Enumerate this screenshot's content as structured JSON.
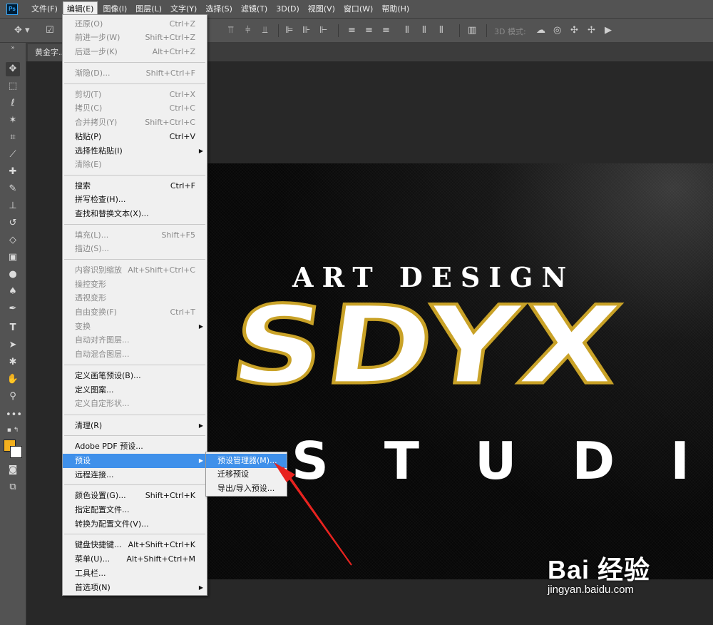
{
  "app": {
    "logo": "Ps"
  },
  "menubar": [
    "文件(F)",
    "编辑(E)",
    "图像(I)",
    "图层(L)",
    "文字(Y)",
    "选择(S)",
    "滤镜(T)",
    "3D(D)",
    "视图(V)",
    "窗口(W)",
    "帮助(H)"
  ],
  "options": {
    "mode3d_label": "3D 模式:"
  },
  "document": {
    "tab_label": "黄金字..."
  },
  "canvas": {
    "art_line": "ART DESIGN",
    "main_logo": "SDYX",
    "studio_line": "STUDI"
  },
  "edit_menu": {
    "items": [
      {
        "label": "还原(O)",
        "shortcut": "Ctrl+Z",
        "disabled": true
      },
      {
        "label": "前进一步(W)",
        "shortcut": "Shift+Ctrl+Z",
        "disabled": true
      },
      {
        "label": "后退一步(K)",
        "shortcut": "Alt+Ctrl+Z",
        "disabled": true
      },
      {
        "label": "渐隐(D)...",
        "shortcut": "Shift+Ctrl+F",
        "disabled": true
      },
      {
        "label": "剪切(T)",
        "shortcut": "Ctrl+X",
        "disabled": true
      },
      {
        "label": "拷贝(C)",
        "shortcut": "Ctrl+C",
        "disabled": true
      },
      {
        "label": "合并拷贝(Y)",
        "shortcut": "Shift+Ctrl+C",
        "disabled": true
      },
      {
        "label": "粘贴(P)",
        "shortcut": "Ctrl+V",
        "disabled": false
      },
      {
        "label": "选择性粘贴(I)",
        "shortcut": "",
        "disabled": false,
        "submenu": true
      },
      {
        "label": "清除(E)",
        "shortcut": "",
        "disabled": true
      },
      {
        "label": "搜索",
        "shortcut": "Ctrl+F",
        "disabled": false
      },
      {
        "label": "拼写检查(H)...",
        "shortcut": "",
        "disabled": false
      },
      {
        "label": "查找和替换文本(X)...",
        "shortcut": "",
        "disabled": false
      },
      {
        "label": "填充(L)...",
        "shortcut": "Shift+F5",
        "disabled": true
      },
      {
        "label": "描边(S)...",
        "shortcut": "",
        "disabled": true
      },
      {
        "label": "内容识别缩放",
        "shortcut": "Alt+Shift+Ctrl+C",
        "disabled": true
      },
      {
        "label": "操控变形",
        "shortcut": "",
        "disabled": true
      },
      {
        "label": "透视变形",
        "shortcut": "",
        "disabled": true
      },
      {
        "label": "自由变换(F)",
        "shortcut": "Ctrl+T",
        "disabled": true
      },
      {
        "label": "变换",
        "shortcut": "",
        "disabled": true,
        "submenu": true
      },
      {
        "label": "自动对齐图层...",
        "shortcut": "",
        "disabled": true
      },
      {
        "label": "自动混合图层...",
        "shortcut": "",
        "disabled": true
      },
      {
        "label": "定义画笔预设(B)...",
        "shortcut": "",
        "disabled": false
      },
      {
        "label": "定义图案...",
        "shortcut": "",
        "disabled": false
      },
      {
        "label": "定义自定形状...",
        "shortcut": "",
        "disabled": true
      },
      {
        "label": "清理(R)",
        "shortcut": "",
        "disabled": false,
        "submenu": true
      },
      {
        "label": "Adobe PDF 预设...",
        "shortcut": "",
        "disabled": false
      },
      {
        "label": "预设",
        "shortcut": "",
        "disabled": false,
        "submenu": true,
        "highlight": true
      },
      {
        "label": "远程连接...",
        "shortcut": "",
        "disabled": false
      },
      {
        "label": "颜色设置(G)...",
        "shortcut": "Shift+Ctrl+K",
        "disabled": false
      },
      {
        "label": "指定配置文件...",
        "shortcut": "",
        "disabled": false
      },
      {
        "label": "转换为配置文件(V)...",
        "shortcut": "",
        "disabled": false
      },
      {
        "label": "键盘快捷键...",
        "shortcut": "Alt+Shift+Ctrl+K",
        "disabled": false
      },
      {
        "label": "菜单(U)...",
        "shortcut": "Alt+Shift+Ctrl+M",
        "disabled": false
      },
      {
        "label": "工具栏...",
        "shortcut": "",
        "disabled": false
      },
      {
        "label": "首选项(N)",
        "shortcut": "",
        "disabled": false,
        "submenu": true
      }
    ]
  },
  "preset_submenu": {
    "items": [
      {
        "label": "预设管理器(M)...",
        "highlight": true
      },
      {
        "label": "迁移预设"
      },
      {
        "label": "导出/导入预设..."
      }
    ]
  },
  "colors": {
    "foreground": "#f2b01f",
    "background": "#ffffff",
    "highlight": "#3f90ea"
  },
  "watermark": {
    "logo": "Bai  经验",
    "url": "jingyan.baidu.com"
  }
}
